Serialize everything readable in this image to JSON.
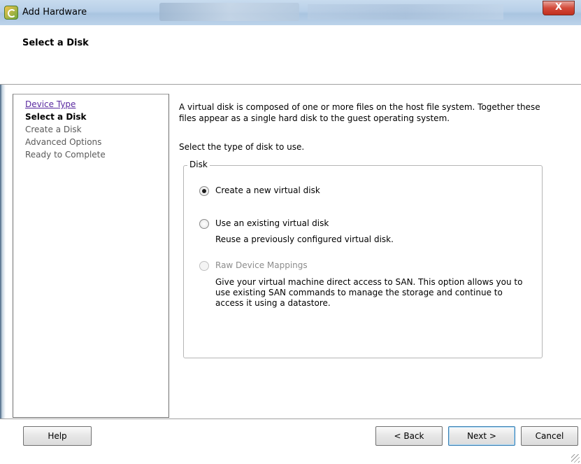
{
  "window": {
    "title": "Add Hardware",
    "close_glyph": "X"
  },
  "header": {
    "title": "Select a Disk"
  },
  "steps": [
    {
      "label": "Device Type",
      "state": "visited"
    },
    {
      "label": "Select a Disk",
      "state": "current"
    },
    {
      "label": "Create a Disk",
      "state": "upcoming"
    },
    {
      "label": "Advanced Options",
      "state": "upcoming"
    },
    {
      "label": "Ready to Complete",
      "state": "upcoming"
    }
  ],
  "content": {
    "intro_line1": "A virtual disk is composed of one or more files on the host file system. Together these",
    "intro_line2": "files appear as a single hard disk to the guest operating system.",
    "select_prompt": "Select the type of disk to use.",
    "group_label": "Disk",
    "options": [
      {
        "label": "Create a new virtual disk",
        "selected": true,
        "enabled": true,
        "description": []
      },
      {
        "label": "Use an existing virtual disk",
        "selected": false,
        "enabled": true,
        "description": [
          "Reuse a previously configured virtual disk."
        ]
      },
      {
        "label": "Raw Device Mappings",
        "selected": false,
        "enabled": false,
        "description": [
          "Give your virtual machine direct access to SAN. This option allows you to",
          "use existing SAN commands to manage the storage and continue to",
          "access it using a datastore."
        ]
      }
    ]
  },
  "footer": {
    "help_label": "Help",
    "back_label": "< Back",
    "next_label": "Next >",
    "cancel_label": "Cancel"
  }
}
